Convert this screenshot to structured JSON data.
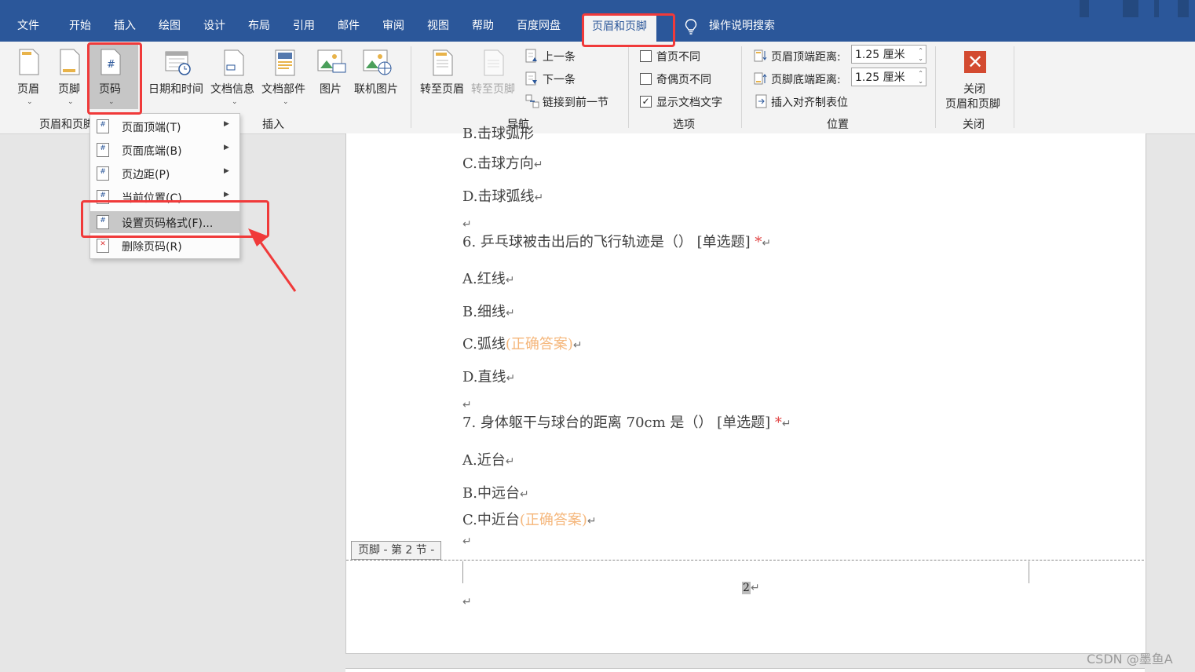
{
  "tabs": [
    "文件",
    "开始",
    "插入",
    "绘图",
    "设计",
    "布局",
    "引用",
    "邮件",
    "审阅",
    "视图",
    "帮助",
    "百度网盘",
    "页眉和页脚"
  ],
  "active_tab": "页眉和页脚",
  "tell_me": "操作说明搜索",
  "ribbon": {
    "header_footer": {
      "header": "页眉",
      "footer": "页脚",
      "page_number": "页码",
      "group": "页眉和页脚"
    },
    "insert": {
      "datetime": "日期和时间",
      "doc_info": "文档信息",
      "quick_parts": "文档部件",
      "pictures": "图片",
      "online_pictures": "联机图片",
      "group": "插入"
    },
    "navigation": {
      "goto_header": "转至页眉",
      "goto_footer": "转至页脚",
      "previous": "上一条",
      "next": "下一条",
      "link_previous": "链接到前一节",
      "group": "导航"
    },
    "options": {
      "diff_first": "首页不同",
      "diff_odd_even": "奇偶页不同",
      "show_doc_text": "显示文档文字",
      "show_doc_text_checked": "✓",
      "group": "选项"
    },
    "position": {
      "header_from_top": "页眉顶端距离:",
      "header_value": "1.25 厘米",
      "footer_from_bottom": "页脚底端距离:",
      "footer_value": "1.25 厘米",
      "insert_align_tab": "插入对齐制表位",
      "group": "位置"
    },
    "close": {
      "close_line1": "关闭",
      "close_line2": "页眉和页脚",
      "group": "关闭"
    }
  },
  "menu": {
    "items": [
      "页面顶端(T)",
      "页面底端(B)",
      "页边距(P)",
      "当前位置(C)",
      "设置页码格式(F)...",
      "删除页码(R)"
    ]
  },
  "document": {
    "cut_line": "B.击球弧形",
    "lines": [
      {
        "text": "C.击球方向",
        "mark": "↵"
      },
      {
        "text": "D.击球弧线",
        "mark": "↵"
      },
      {
        "text": "",
        "mark": "↵"
      },
      {
        "text": "6. 乒乓球被击出后的飞行轨迹是（） [单选题] ",
        "req": "*",
        "mark": "↵"
      },
      {
        "text": "A.红线",
        "mark": "↵"
      },
      {
        "text": "B.细线",
        "mark": "↵"
      },
      {
        "text": "C.弧线",
        "ans": "(正确答案)",
        "mark": "↵"
      },
      {
        "text": "D.直线",
        "mark": "↵"
      },
      {
        "text": "",
        "mark": "↵"
      },
      {
        "text": "7. 身体躯干与球台的距离 70cm 是（） [单选题] ",
        "req": "*",
        "mark": "↵"
      },
      {
        "text": "A.近台",
        "mark": "↵"
      },
      {
        "text": "B.中远台",
        "mark": "↵"
      },
      {
        "text": "C.中近台",
        "ans": "(正确答案)",
        "mark": "↵"
      },
      {
        "text": "",
        "mark": "↵"
      }
    ],
    "footer_tag": "页脚 - 第 2 节 -",
    "page_number": "2",
    "footer_mark": "↵",
    "empty_mark": "↵"
  },
  "watermark": "CSDN @墨鱼A",
  "colors": {
    "tabbar": "#2b579a",
    "ribbon": "#f3f3f3",
    "highlight": "#f03a3a",
    "answer": "#f5b67a"
  }
}
